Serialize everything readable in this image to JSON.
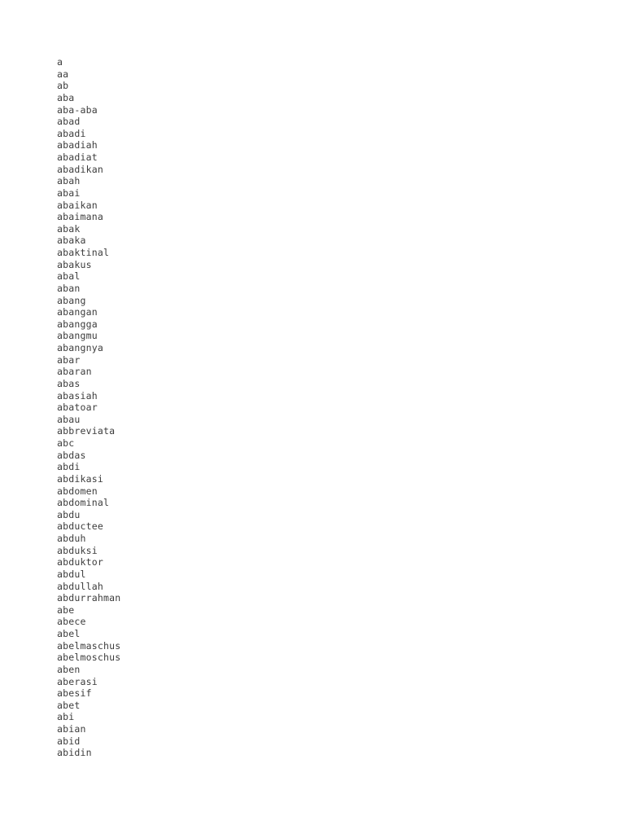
{
  "document": {
    "background_color": "#ffffff",
    "text_color": "#3c3c3c",
    "entries": [
      "a",
      "aa",
      "ab",
      "aba",
      "aba-aba",
      "abad",
      "abadi",
      "abadiah",
      "abadiat",
      "abadikan",
      "abah",
      "abai",
      "abaikan",
      "abaimana",
      "abak",
      "abaka",
      "abaktinal",
      "abakus",
      "abal",
      "aban",
      "abang",
      "abangan",
      "abangga",
      "abangmu",
      "abangnya",
      "abar",
      "abaran",
      "abas",
      "abasiah",
      "abatoar",
      "abau",
      "abbreviata",
      "abc",
      "abdas",
      "abdi",
      "abdikasi",
      "abdomen",
      "abdominal",
      "abdu",
      "abductee",
      "abduh",
      "abduksi",
      "abduktor",
      "abdul",
      "abdullah",
      "abdurrahman",
      "abe",
      "abece",
      "abel",
      "abelmaschus",
      "abelmoschus",
      "aben",
      "aberasi",
      "abesif",
      "abet",
      "abi",
      "abian",
      "abid",
      "abidin"
    ]
  }
}
